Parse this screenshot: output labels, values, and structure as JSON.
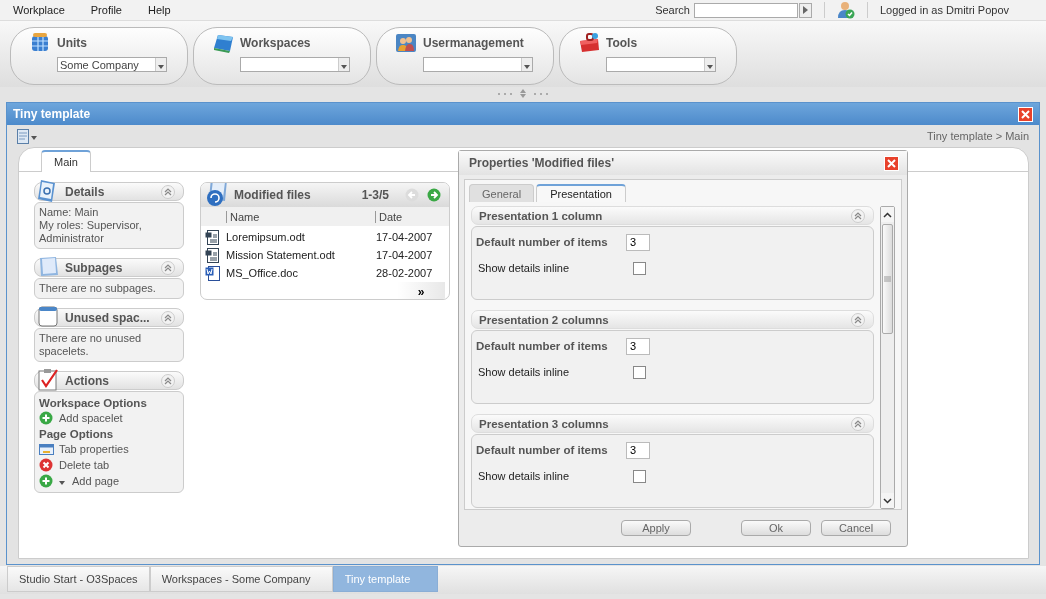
{
  "menu": [
    {
      "label": "Workplace"
    },
    {
      "label": "Profile"
    },
    {
      "label": "Help"
    }
  ],
  "search": {
    "label": "Search"
  },
  "user": {
    "text": "Logged in as Dmitri Popov"
  },
  "modules": [
    {
      "label": "Units",
      "kind": "units",
      "value": "Some Company"
    },
    {
      "label": "Workspaces",
      "kind": "workspaces"
    },
    {
      "label": "Usermanagement",
      "kind": "users"
    },
    {
      "label": "Tools",
      "kind": "tools"
    }
  ],
  "window": {
    "title": "Tiny template",
    "breadcrumb": "Tiny template  >  Main",
    "tabs": [
      {
        "label": "Main",
        "selected": true
      }
    ]
  },
  "widgets": [
    {
      "title": "Details",
      "kind": "details",
      "lines": [
        "Name: Main",
        "My roles: Supervisor, Administrator"
      ]
    },
    {
      "title": "Subpages",
      "kind": "subpages",
      "lines": [
        "There are no subpages."
      ]
    },
    {
      "title": "Unused spac...",
      "kind": "unused",
      "lines": [
        "There are no unused spacelets."
      ]
    },
    {
      "title": "Actions",
      "kind": "actions",
      "sections": [
        {
          "heading": "Workspace Options",
          "items": [
            {
              "label": "Add spacelet",
              "kind": "add"
            }
          ]
        },
        {
          "heading": "Page Options",
          "items": [
            {
              "label": "Tab properties",
              "kind": "properties"
            },
            {
              "label": "Delete tab",
              "kind": "delete"
            },
            {
              "label": "Add page",
              "kind": "addmenu"
            }
          ]
        }
      ]
    }
  ],
  "files": {
    "title": "Modified files",
    "pager": "1-3/5",
    "prev_enabled": false,
    "next_enabled": true,
    "columns": [
      "Name",
      "Date"
    ],
    "rows": [
      {
        "name": "Loremipsum.odt",
        "date": "17-04-2007",
        "kind": "odt"
      },
      {
        "name": "Mission Statement.odt",
        "date": "17-04-2007",
        "kind": "odt"
      },
      {
        "name": "MS_Office.doc",
        "date": "28-02-2007",
        "kind": "doc"
      }
    ],
    "more": "»"
  },
  "dialog": {
    "title": "Properties 'Modified files'",
    "tabs": [
      {
        "label": "General",
        "selected": false
      },
      {
        "label": "Presentation",
        "selected": true
      }
    ],
    "sections": [
      {
        "title": "Presentation 1 column",
        "items_label": "Default number of items",
        "items_value": "3",
        "inline_label": "Show details inline",
        "inline_checked": false
      },
      {
        "title": "Presentation 2 columns",
        "items_label": "Default number of items",
        "items_value": "3",
        "inline_label": "Show details inline",
        "inline_checked": false
      },
      {
        "title": "Presentation 3 columns",
        "items_label": "Default number of items",
        "items_value": "3",
        "inline_label": "Show details inline",
        "inline_checked": false
      }
    ],
    "buttons": [
      "Apply",
      "Ok",
      "Cancel"
    ]
  },
  "taskbar": [
    {
      "label": "Studio Start - O3Spaces",
      "selected": false
    },
    {
      "label": "Workspaces - Some Company",
      "selected": false
    },
    {
      "label": "Tiny template",
      "selected": true
    }
  ]
}
